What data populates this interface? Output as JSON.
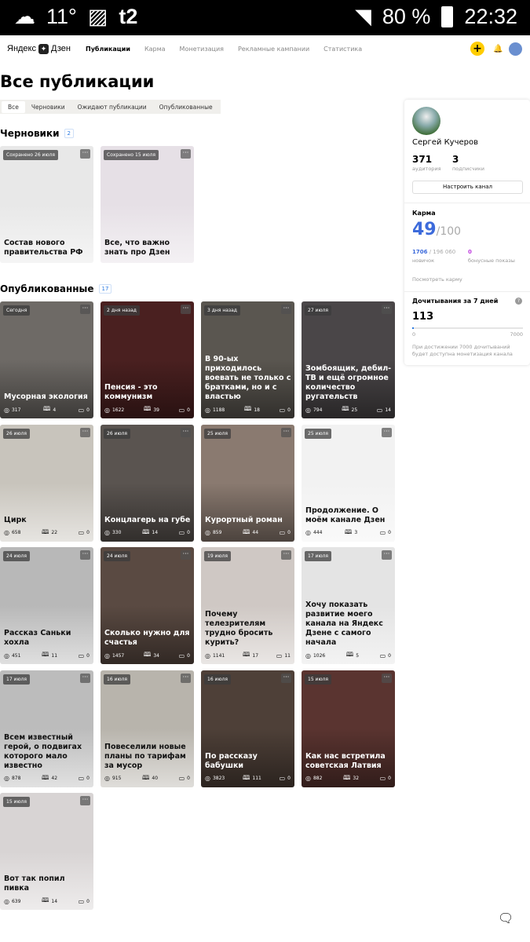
{
  "status_bar": {
    "temp": "11°",
    "battery": "80 %",
    "time": "22:32",
    "network": "t2"
  },
  "header": {
    "logo": "Яндекс",
    "logo_brand": "Дзен",
    "nav": [
      "Публикации",
      "Карма",
      "Монетизация",
      "Рекламные кампании",
      "Статистика"
    ]
  },
  "page_title": "Все публикации",
  "tabs": [
    "Все",
    "Черновики",
    "Ожидают публикации",
    "Опубликованные"
  ],
  "drafts": {
    "title": "Черновики",
    "count": "2",
    "items": [
      {
        "badge": "Сохранено 26 июля",
        "title": "Состав нового правительства РФ",
        "bg": "#e8e8e8",
        "theme": "light"
      },
      {
        "badge": "Сохранено 15 июля",
        "title": "Все, что важно знать про Дзен",
        "bg": "#e6e0e6",
        "theme": "light"
      }
    ]
  },
  "published": {
    "title": "Опубликованные",
    "count": "17",
    "items": [
      {
        "badge": "Сегодня",
        "title": "Мусорная экология",
        "views": "317",
        "reads": "4",
        "comments": "0",
        "bg": "#6e6a66",
        "theme": "dark"
      },
      {
        "badge": "2 дня назад",
        "title": "Пенсия - это коммунизм",
        "views": "1622",
        "reads": "39",
        "comments": "0",
        "bg": "#4a2020",
        "theme": "dark"
      },
      {
        "badge": "3 дня назад",
        "title": "В 90-ых приходилось воевать не только с братками, но и с властью",
        "views": "1188",
        "reads": "18",
        "comments": "0",
        "bg": "#5a5650",
        "theme": "dark"
      },
      {
        "badge": "27 июля",
        "title": "Зомбоящик, дебил-ТВ и ещё огромное количество ругательств",
        "views": "794",
        "reads": "25",
        "comments": "14",
        "bg": "#4a4648",
        "theme": "dark"
      },
      {
        "badge": "26 июля",
        "title": "Цирк",
        "views": "658",
        "reads": "22",
        "comments": "0",
        "bg": "#c8c4bc",
        "theme": "light"
      },
      {
        "badge": "26 июля",
        "title": "Концлагерь на губе",
        "views": "330",
        "reads": "14",
        "comments": "0",
        "bg": "#5a5450",
        "theme": "dark"
      },
      {
        "badge": "25 июля",
        "title": "Курортный роман",
        "views": "859",
        "reads": "44",
        "comments": "0",
        "bg": "#8a7a70",
        "theme": "dark"
      },
      {
        "badge": "25 июля",
        "title": "Продолжение. О моём канале Дзен",
        "views": "444",
        "reads": "3",
        "comments": "0",
        "bg": "#f2f2f2",
        "theme": "light"
      },
      {
        "badge": "24 июля",
        "title": "Рассказ Саньки хохла",
        "views": "451",
        "reads": "11",
        "comments": "0",
        "bg": "#b8b8b8",
        "theme": "light"
      },
      {
        "badge": "24 июля",
        "title": "Сколько нужно для счастья",
        "views": "1457",
        "reads": "34",
        "comments": "0",
        "bg": "#5a4a42",
        "theme": "dark"
      },
      {
        "badge": "19 июля",
        "title": "Почему телезрителям трудно бросить курить?",
        "views": "1141",
        "reads": "17",
        "comments": "11",
        "bg": "#cfc8c4",
        "theme": "light"
      },
      {
        "badge": "17 июля",
        "title": "Хочу показать развитие моего канала на Яндекс Дзене с самого начала",
        "views": "1026",
        "reads": "5",
        "comments": "0",
        "bg": "#e4e4e4",
        "theme": "light"
      },
      {
        "badge": "17 июля",
        "title": "Всем известный герой, о подвигах которого мало известно",
        "views": "878",
        "reads": "42",
        "comments": "0",
        "bg": "#bcbcbc",
        "theme": "light"
      },
      {
        "badge": "16 июля",
        "title": "Повеселили новые планы по тарифам за мусор",
        "views": "915",
        "reads": "40",
        "comments": "0",
        "bg": "#b8b4ac",
        "theme": "light"
      },
      {
        "badge": "16 июля",
        "title": "По рассказу бабушки",
        "views": "3823",
        "reads": "111",
        "comments": "0",
        "bg": "#4e4038",
        "theme": "dark"
      },
      {
        "badge": "15 июля",
        "title": "Как нас встретила советская Латвия",
        "views": "882",
        "reads": "32",
        "comments": "0",
        "bg": "#5a3430",
        "theme": "dark"
      },
      {
        "badge": "15 июля",
        "title": "Вот так попил пивка",
        "views": "639",
        "reads": "14",
        "comments": "0",
        "bg": "#d8d4d4",
        "theme": "light"
      }
    ]
  },
  "profile": {
    "name": "Сергей Кучеров",
    "audience": "371",
    "audience_label": "аудитория",
    "subscribers": "3",
    "subscribers_label": "подписчики",
    "setup_button": "Настроить канал",
    "karma_title": "Карма",
    "karma_value": "49",
    "karma_max": "/100",
    "shows": "1706",
    "shows_max": " / 196 060",
    "shows_label": "новичок",
    "bonus": "0",
    "bonus_label": "бонусные показы",
    "karma_link": "Посмотреть карму",
    "reads_title": "Дочитывания за 7 дней",
    "reads_value": "113",
    "reads_progress": 0.016,
    "scale_min": "0",
    "scale_max": "7000",
    "reads_note": "При достижении 7000 дочитываний будет доступна монетизация канала"
  }
}
